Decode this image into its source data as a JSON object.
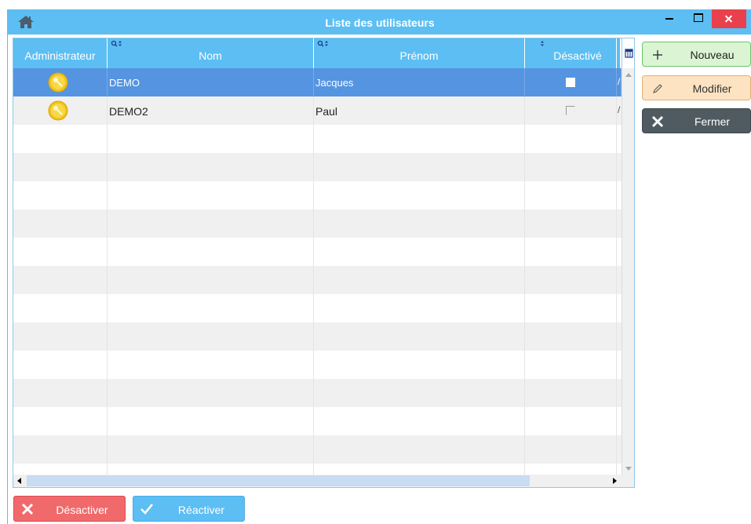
{
  "window": {
    "title": "Liste des utilisateurs",
    "controls": {
      "minimize": "minimize",
      "maximize": "maximize",
      "close": "close"
    }
  },
  "grid": {
    "columns": {
      "administrateur": "Administrateur",
      "nom": "Nom",
      "prenom": "Prénom",
      "desactive": "Désactivé"
    },
    "rows": [
      {
        "admin": true,
        "nom": "DEMO",
        "prenom": "Jacques",
        "desactive": false,
        "selected": true,
        "extra": "/"
      },
      {
        "admin": true,
        "nom": "DEMO2",
        "prenom": "Paul",
        "desactive": false,
        "selected": false,
        "extra": "/"
      }
    ],
    "empty_row_count": 12
  },
  "side_buttons": {
    "new": "Nouveau",
    "edit": "Modifier",
    "close": "Fermer"
  },
  "bottom_buttons": {
    "deactivate": "Désactiver",
    "reactivate": "Réactiver"
  },
  "colors": {
    "header": "#5cbef3",
    "selection": "#5594e1",
    "new_button": "#dbf5d4",
    "edit_button": "#fde3c1",
    "close_button": "#4f5b61",
    "deactivate_button": "#f06a6c",
    "reactivate_button": "#5cbef3"
  },
  "icons": {
    "home": "home-icon",
    "admin": "key-badge-icon",
    "sort": "search-sort-icon",
    "column_picker": "column-picker-icon",
    "new": "plus-icon",
    "edit": "pencil-icon",
    "close": "x-icon",
    "deactivate": "x-icon",
    "reactivate": "check-icon"
  }
}
